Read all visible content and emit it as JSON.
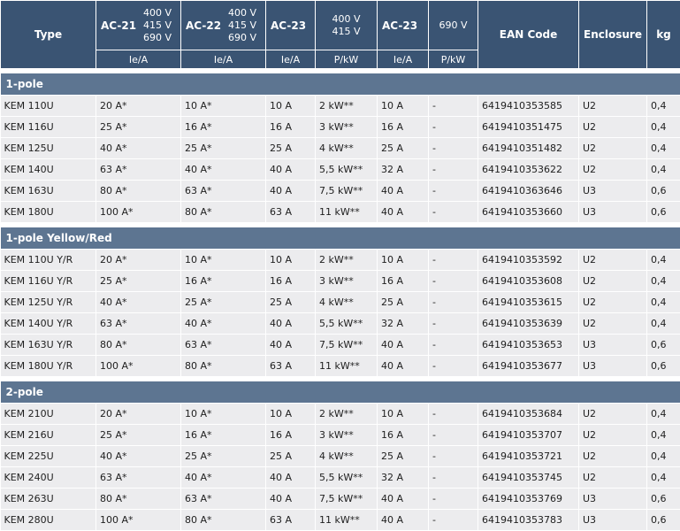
{
  "header": {
    "type": "Type",
    "ac21": "AC-21",
    "ac22": "AC-22",
    "ac23": "AC-23",
    "ac23b": "AC-23",
    "v400": "400 V",
    "v415": "415 V",
    "v690": "690 V",
    "v690b": "690 V",
    "ean": "EAN Code",
    "enclosure": "Enclosure",
    "kg": "kg",
    "ie_a": "Ie/A",
    "p_kw": "P/kW"
  },
  "sections": [
    {
      "title": "1-pole",
      "rows": [
        [
          "KEM 110U",
          "20 A*",
          "10 A*",
          "10 A",
          "2 kW**",
          "10 A",
          "-",
          "6419410353585",
          "U2",
          "0,4"
        ],
        [
          "KEM 116U",
          "25 A*",
          "16 A*",
          "16 A",
          "3 kW**",
          "16 A",
          "-",
          "6419410351475",
          "U2",
          "0,4"
        ],
        [
          "KEM 125U",
          "40 A*",
          "25 A*",
          "25 A",
          "4 kW**",
          "25 A",
          "-",
          "6419410351482",
          "U2",
          "0,4"
        ],
        [
          "KEM 140U",
          "63 A*",
          "40 A*",
          "40 A",
          "5,5 kW**",
          "32 A",
          "-",
          "6419410353622",
          "U2",
          "0,4"
        ],
        [
          "KEM 163U",
          "80 A*",
          "63 A*",
          "40 A",
          "7,5 kW**",
          "40 A",
          "-",
          "6419410363646",
          "U3",
          "0,6"
        ],
        [
          "KEM 180U",
          "100 A*",
          "80 A*",
          "63 A",
          "11 kW**",
          "40 A",
          "-",
          "6419410353660",
          "U3",
          "0,6"
        ]
      ]
    },
    {
      "title": "1-pole Yellow/Red",
      "rows": [
        [
          "KEM 110U Y/R",
          "20 A*",
          "10 A*",
          "10 A",
          "2 kW**",
          "10 A",
          "-",
          "6419410353592",
          "U2",
          "0,4"
        ],
        [
          "KEM 116U Y/R",
          "25 A*",
          "16 A*",
          "16 A",
          "3 kW**",
          "16 A",
          "-",
          "6419410353608",
          "U2",
          "0,4"
        ],
        [
          "KEM 125U Y/R",
          "40 A*",
          "25 A*",
          "25 A",
          "4 kW**",
          "25 A",
          "-",
          "6419410353615",
          "U2",
          "0,4"
        ],
        [
          "KEM 140U Y/R",
          "63 A*",
          "40 A*",
          "40 A",
          "5,5 kW**",
          "32 A",
          "-",
          "6419410353639",
          "U2",
          "0,4"
        ],
        [
          "KEM 163U Y/R",
          "80 A*",
          "63 A*",
          "40 A",
          "7,5 kW**",
          "40 A",
          "-",
          "6419410353653",
          "U3",
          "0,6"
        ],
        [
          "KEM 180U Y/R",
          "100 A*",
          "80 A*",
          "63 A",
          "11 kW**",
          "40 A",
          "-",
          "6419410353677",
          "U3",
          "0,6"
        ]
      ]
    },
    {
      "title": "2-pole",
      "rows": [
        [
          "KEM 210U",
          "20 A*",
          "10 A*",
          "10 A",
          "2 kW**",
          "10 A",
          "-",
          "6419410353684",
          "U2",
          "0,4"
        ],
        [
          "KEM 216U",
          "25 A*",
          "16 A*",
          "16 A",
          "3 kW**",
          "16 A",
          "-",
          "6419410353707",
          "U2",
          "0,4"
        ],
        [
          "KEM 225U",
          "40 A*",
          "25 A*",
          "25 A",
          "4 kW**",
          "25 A",
          "-",
          "6419410353721",
          "U2",
          "0,4"
        ],
        [
          "KEM 240U",
          "63 A*",
          "40 A*",
          "40 A",
          "5,5 kW**",
          "32 A",
          "-",
          "6419410353745",
          "U2",
          "0,4"
        ],
        [
          "KEM 263U",
          "80 A*",
          "63 A*",
          "40 A",
          "7,5 kW**",
          "40 A",
          "-",
          "6419410353769",
          "U3",
          "0,6"
        ],
        [
          "KEM 280U",
          "100 A*",
          "80 A*",
          "63 A",
          "11 kW**",
          "40 A",
          "-",
          "6419410353783",
          "U3",
          "0,6"
        ]
      ]
    }
  ]
}
